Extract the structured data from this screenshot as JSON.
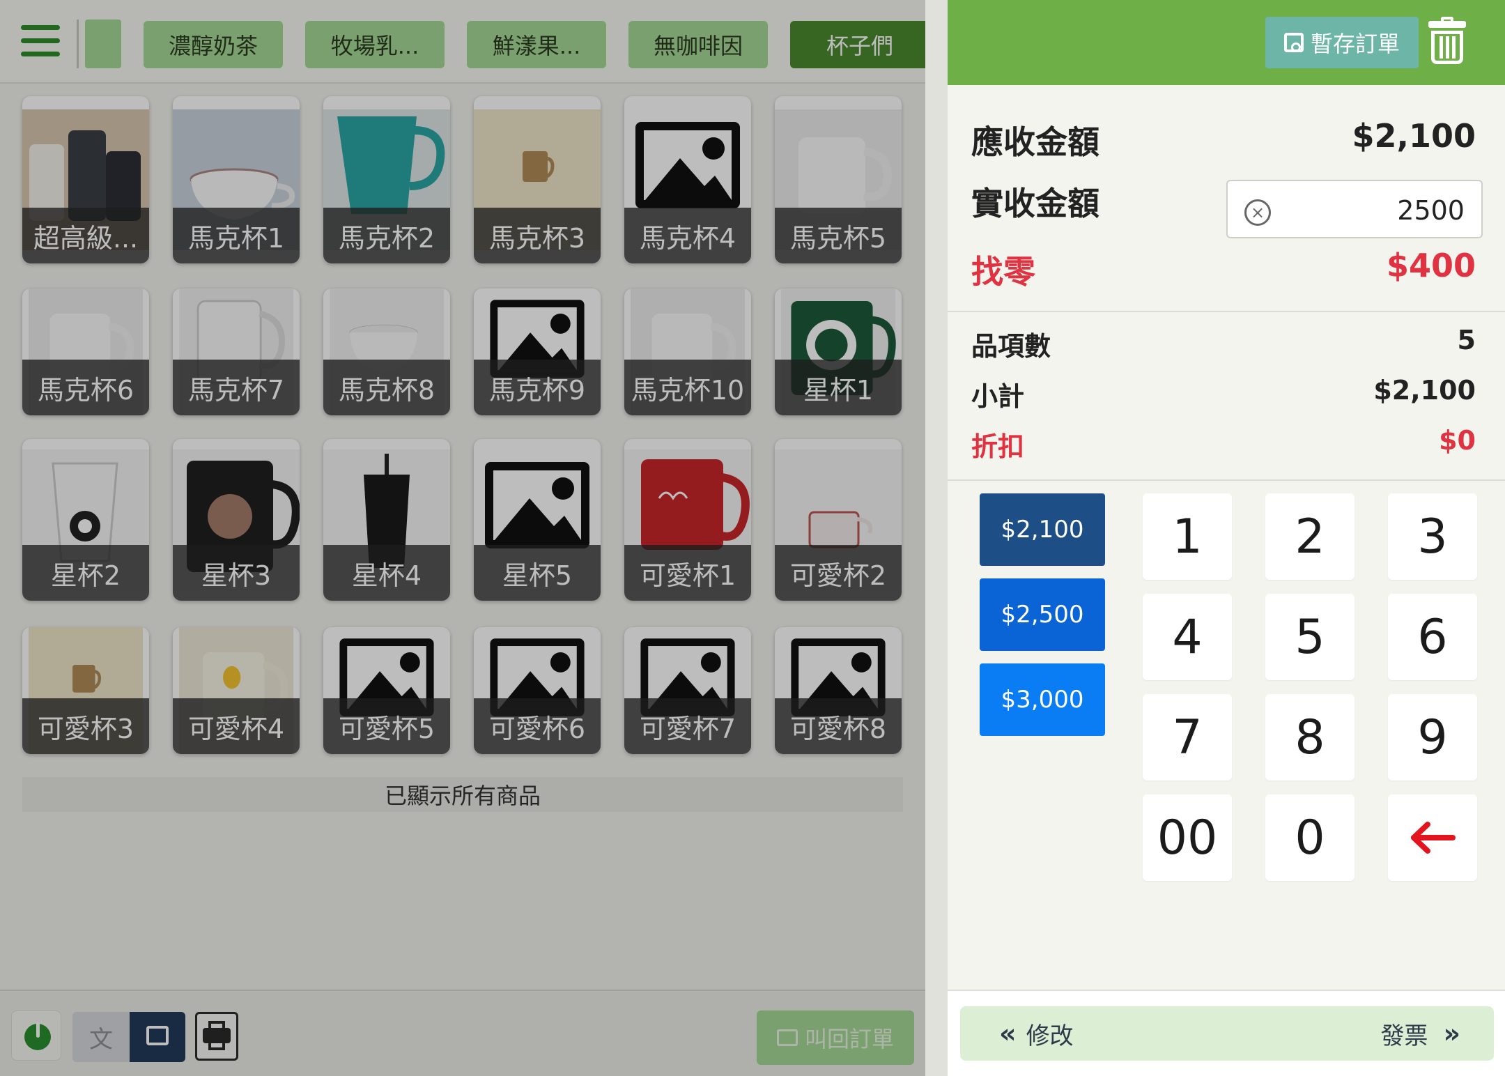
{
  "categories": [
    {
      "label": "濃醇奶茶",
      "active": false
    },
    {
      "label": "牧場乳...",
      "active": false
    },
    {
      "label": "鮮漾果...",
      "active": false
    },
    {
      "label": "無咖啡因",
      "active": false
    },
    {
      "label": "杯子們",
      "active": true
    }
  ],
  "products": [
    {
      "name": "超高級...",
      "image": "photo-cups"
    },
    {
      "name": "馬克杯1",
      "image": "photo-cup"
    },
    {
      "name": "馬克杯2",
      "image": "photo-teal-mug"
    },
    {
      "name": "馬克杯3",
      "image": "photo-gold-mug"
    },
    {
      "name": "馬克杯4",
      "image": "placeholder-image-icon"
    },
    {
      "name": "馬克杯5",
      "image": "photo-white-mug"
    },
    {
      "name": "馬克杯6",
      "image": "photo-white-mug"
    },
    {
      "name": "馬克杯7",
      "image": "photo-glass-mug"
    },
    {
      "name": "馬克杯8",
      "image": "photo-white-cup"
    },
    {
      "name": "馬克杯9",
      "image": "placeholder-image-icon"
    },
    {
      "name": "馬克杯10",
      "image": "photo-white-mug"
    },
    {
      "name": "星杯1",
      "image": "photo-green-starbucks-mug"
    },
    {
      "name": "星杯2",
      "image": "photo-glass-starbucks-cup"
    },
    {
      "name": "星杯3",
      "image": "photo-black-starbucks-mug"
    },
    {
      "name": "星杯4",
      "image": "photo-black-tumbler"
    },
    {
      "name": "星杯5",
      "image": "placeholder-image-icon"
    },
    {
      "name": "可愛杯1",
      "image": "photo-red-mug"
    },
    {
      "name": "可愛杯2",
      "image": "photo-plaid-mug"
    },
    {
      "name": "可愛杯3",
      "image": "photo-gold-mug"
    },
    {
      "name": "可愛杯4",
      "image": "photo-duck-mug"
    },
    {
      "name": "可愛杯5",
      "image": "placeholder-image-icon"
    },
    {
      "name": "可愛杯6",
      "image": "placeholder-image-icon"
    },
    {
      "name": "可愛杯7",
      "image": "placeholder-image-icon"
    },
    {
      "name": "可愛杯8",
      "image": "placeholder-image-icon"
    }
  ],
  "list_end_text": "已顯示所有商品",
  "bottom_left": {
    "mode_text_label": "文",
    "recall_label": "叫回訂單"
  },
  "header": {
    "save_label": "暫存訂單"
  },
  "payment": {
    "due_label": "應收金額",
    "due_value": "$2,100",
    "received_label": "實收金額",
    "received_value": "2500",
    "change_label": "找零",
    "change_value": "$400"
  },
  "summary": {
    "items_label": "品項數",
    "items_value": "5",
    "subtotal_label": "小計",
    "subtotal_value": "$2,100",
    "discount_label": "折扣",
    "discount_value": "$0"
  },
  "quick_amounts": [
    {
      "label": "$2,100",
      "color": "#1e4e86"
    },
    {
      "label": "$2,500",
      "color": "#0a64d6"
    },
    {
      "label": "$3,000",
      "color": "#0a7cf4"
    }
  ],
  "keypad": [
    "1",
    "2",
    "3",
    "4",
    "5",
    "6",
    "7",
    "8",
    "9",
    "00",
    "0",
    "backspace"
  ],
  "footer": {
    "edit_label": "修改",
    "invoice_label": "發票"
  },
  "colors": {
    "header_green": "#6faf48",
    "accent_red": "#e03240",
    "category_green": "#a7d897",
    "category_active": "#4b8a2f"
  }
}
